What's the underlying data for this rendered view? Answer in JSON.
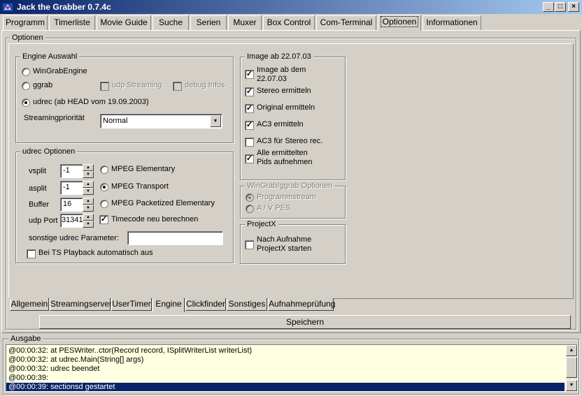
{
  "window": {
    "title": "Jack the Grabber 0.7.4c",
    "minimize": "_",
    "maximize": "□",
    "close": "×"
  },
  "main_tabs": [
    "Programm",
    "Timerliste",
    "Movie Guide",
    "Suche",
    "Serien",
    "Muxer",
    "Box Control",
    "Com-Terminal",
    "Optionen",
    "Informationen"
  ],
  "options_group": "Optionen",
  "engine": {
    "legend": "Engine Auswahl",
    "radio_wingrab": "WinGrabEngine",
    "radio_ggrab": "ggrab",
    "udp_streaming": "udp Streaming",
    "debug_infos": "debug Infos",
    "radio_udrec": "udrec (ab HEAD vom 19.09.2003)",
    "priority_label": "Streamingpriorität",
    "priority_value": "Normal"
  },
  "udrec": {
    "legend": "udrec Optionen",
    "vsplit_label": "vsplit",
    "vsplit_value": "-1",
    "asplit_label": "asplit",
    "asplit_value": "-1",
    "buffer_label": "Buffer",
    "buffer_value": "16",
    "udp_port_label": "udp Port",
    "udp_port_value": "31341",
    "mpeg_elementary": "MPEG Elementary",
    "mpeg_transport": "MPEG Transport",
    "mpeg_pes": "MPEG Packetized Elementary",
    "timecode": "Timecode neu berechnen",
    "other_params_label": "sonstige udrec Parameter:",
    "other_params_value": "",
    "ts_playback": "Bei TS Playback automatisch aus"
  },
  "image": {
    "legend": "Image ab 22.07.03",
    "image_ab_line1": "Image ab dem",
    "image_ab_line2": "22.07.03",
    "stereo": "Stereo ermitteln",
    "original": "Original ermitteln",
    "ac3": "AC3 ermitteln",
    "ac3_stereo": "AC3 für Stereo rec.",
    "all_pids_line1": "Alle ermittelten",
    "all_pids_line2": "Pids aufnehmen"
  },
  "wingrab": {
    "legend": "WinGrab/ggrab Optionen",
    "programmstream": "Programmstream",
    "av_pes": "A / V PES"
  },
  "projectx": {
    "legend": "ProjectX",
    "start_line1": "Nach Aufnahme",
    "start_line2": "ProjectX starten"
  },
  "sub_tabs": [
    "Allgemein",
    "Streamingserver",
    "UserTimer",
    "Engine",
    "Clickfinder",
    "Sonstiges",
    "Aufnahmeprüfung"
  ],
  "save_button": "Speichern",
  "output": {
    "legend": "Ausgabe",
    "lines": [
      "@00:00:32:     at PESWriter..ctor(Record record, ISplitWriterList writerList)",
      "@00:00:32:     at udrec.Main(String[] args)",
      "@00:00:32: udrec beendet",
      "@00:00:39:",
      "@00:00:39: sectionsd gestartet"
    ]
  },
  "colors": {
    "titlebar": "#0a246a",
    "selection": "#0a246a",
    "log_background": "#ffffe1"
  }
}
